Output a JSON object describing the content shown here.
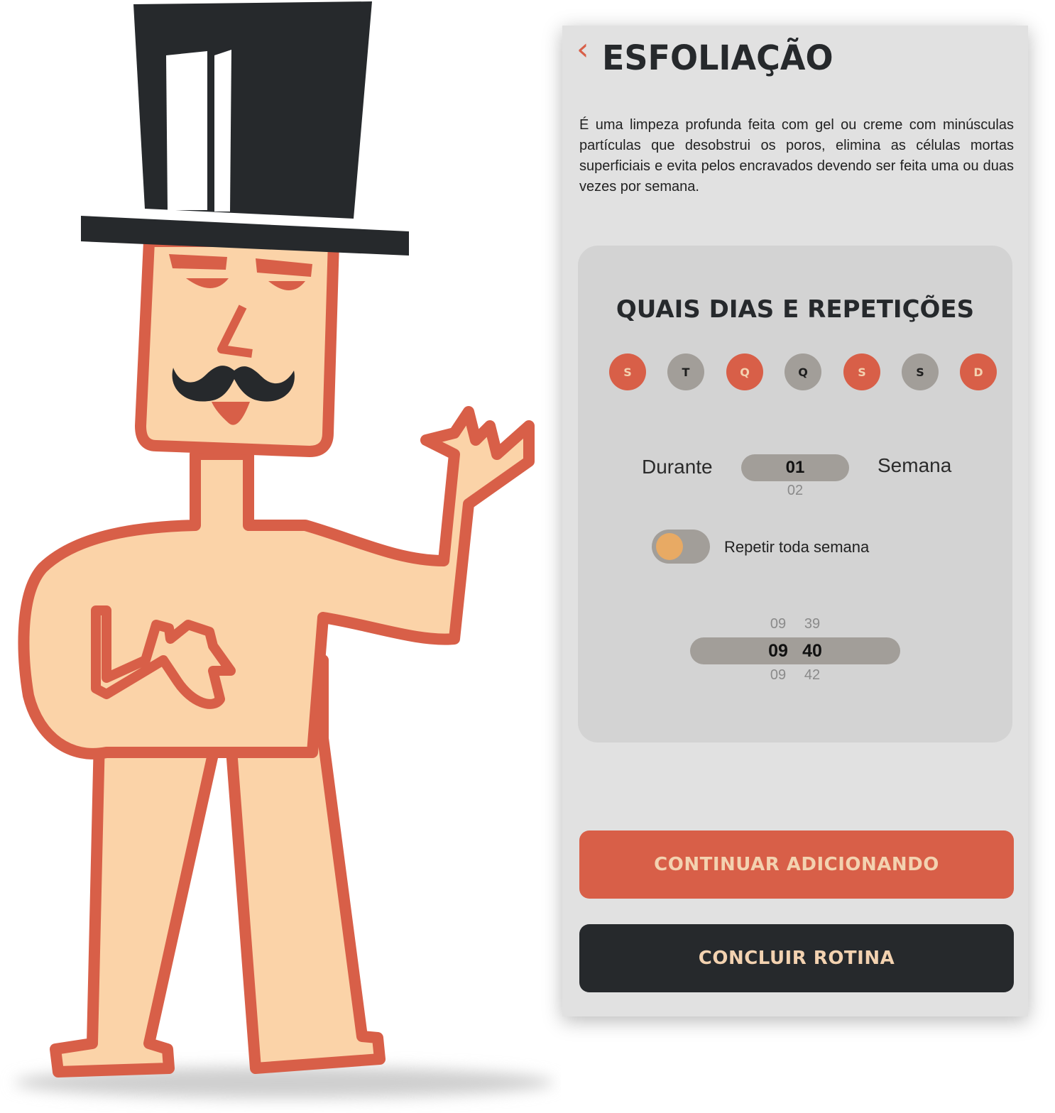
{
  "header": {
    "back_icon": "chevron-left-icon",
    "title": "ESFOLIAÇÃO"
  },
  "description": "É uma limpeza profunda feita com gel ou creme com minúsculas partículas que desobstrui os poros, elimina as células mortas superficiais e evita pelos encravados devendo ser feita uma ou duas vezes por semana.",
  "schedule": {
    "title": "QUAIS DIAS E REPETIÇÕES",
    "days": [
      {
        "label": "S",
        "selected": true
      },
      {
        "label": "T",
        "selected": false
      },
      {
        "label": "Q",
        "selected": true
      },
      {
        "label": "Q",
        "selected": false
      },
      {
        "label": "S",
        "selected": true
      },
      {
        "label": "S",
        "selected": false
      },
      {
        "label": "D",
        "selected": true
      }
    ],
    "duration": {
      "prefix": "Durante",
      "selected": "01",
      "next": "02",
      "suffix": "Semana"
    },
    "repeat": {
      "label": "Repetir toda semana",
      "on": false
    },
    "time": {
      "prev": {
        "hour": "09",
        "minute": "39"
      },
      "selected": {
        "hour": "09",
        "minute": "40"
      },
      "next": {
        "hour": "09",
        "minute": "42"
      }
    }
  },
  "actions": {
    "continue_label": "CONTINUAR ADICIONANDO",
    "finish_label": "CONCLUIR ROTINA"
  },
  "colors": {
    "accent": "#d85f48",
    "dark": "#26292c",
    "panel": "#e1e1e1",
    "card": "#d3d3d3",
    "chip_off": "#a29e99",
    "skin": "#fbd3a8",
    "knob": "#e8aa64"
  },
  "illustration": {
    "name": "mustache-man-top-hat"
  }
}
